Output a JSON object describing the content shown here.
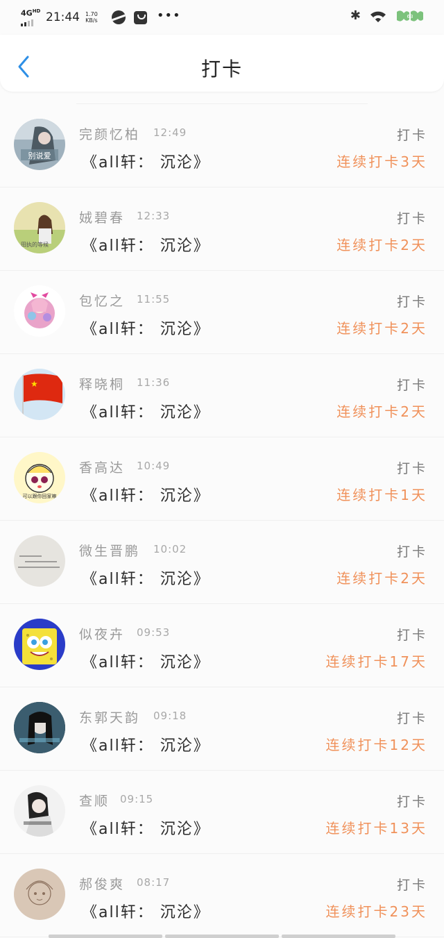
{
  "status_bar": {
    "network": "4G",
    "network_sup": "HD",
    "time": "21:44",
    "speed_value": "1.70",
    "speed_unit": "KB/s",
    "battery": "63"
  },
  "header": {
    "title": "打卡"
  },
  "colors": {
    "accent_blue": "#2e8fe6",
    "streak_orange": "#f0915a"
  },
  "checkins": [
    {
      "name": "完颜忆柏",
      "time": "12:49",
      "book": "《all轩：  沉沦》",
      "action": "打卡",
      "streak": "连续打卡3天",
      "avatar": "avatar-girl-grey"
    },
    {
      "name": "娀碧春",
      "time": "12:33",
      "book": "《all轩：  沉沦》",
      "action": "打卡",
      "streak": "连续打卡2天",
      "avatar": "avatar-girl-field"
    },
    {
      "name": "包忆之",
      "time": "11:55",
      "book": "《all轩：  沉沦》",
      "action": "打卡",
      "streak": "连续打卡2天",
      "avatar": "avatar-anime-flowers"
    },
    {
      "name": "释晓桐",
      "time": "11:36",
      "book": "《all轩：  沉沦》",
      "action": "打卡",
      "streak": "连续打卡2天",
      "avatar": "avatar-flag"
    },
    {
      "name": "香高达",
      "time": "10:49",
      "book": "《all轩：  沉沦》",
      "action": "打卡",
      "streak": "连续打卡1天",
      "avatar": "avatar-cartoon-face"
    },
    {
      "name": "微生晋鹏",
      "time": "10:02",
      "book": "《all轩：  沉沦》",
      "action": "打卡",
      "streak": "连续打卡2天",
      "avatar": "avatar-handwriting"
    },
    {
      "name": "似夜卉",
      "time": "09:53",
      "book": "《all轩：  沉沦》",
      "action": "打卡",
      "streak": "连续打卡17天",
      "avatar": "avatar-spongebob"
    },
    {
      "name": "东郭天韵",
      "time": "09:18",
      "book": "《all轩：  沉沦》",
      "action": "打卡",
      "streak": "连续打卡12天",
      "avatar": "avatar-dark-girl"
    },
    {
      "name": "查顺",
      "time": "09:15",
      "book": "《all轩：  沉沦》",
      "action": "打卡",
      "streak": "连续打卡13天",
      "avatar": "avatar-bw-girl"
    },
    {
      "name": "郝俊爽",
      "time": "08:17",
      "book": "《all轩：  沉沦》",
      "action": "打卡",
      "streak": "连续打卡23天",
      "avatar": "avatar-sketch"
    }
  ]
}
